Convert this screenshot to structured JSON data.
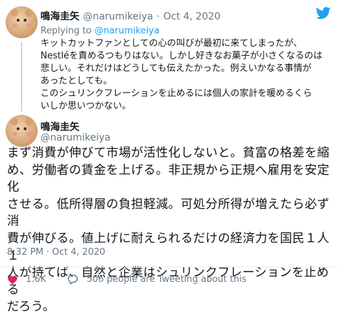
{
  "reply_tweet": {
    "display_name": "鳴海圭矢",
    "handle": "@narumikeiya",
    "dot": "·",
    "date": "Oct 4, 2020",
    "replying_prefix": "Replying to",
    "replying_to": "@narumikeiya",
    "lines": [
      "キットカットファンとしての心の叫びが最初に来てしまったが、",
      "Nestléを責めるつもりはない。しかし好きなお菓子が小さくなるのは",
      "悲しい。それだけはどうしても伝えたかった。例えいかなる事情が",
      "あったとしても。",
      "このシュリンクフレーションを止めるには個人の家計を暖めるくら",
      "いしか思いつかない。"
    ]
  },
  "main_tweet": {
    "display_name": "鳴海圭矢",
    "handle": "@narumikeiya",
    "lines": [
      "まず消費が伸びて市場が活性化しないと。貧富の格差を縮",
      "め、労働者の賃金を上げる。非正規から正規へ雇用を安定化",
      "させる。低所得層の負担軽減。可処分所得が増えたら必ず消",
      "費が伸びる。値上げに耐えられるだけの経済力を国民１人１",
      "人が持てば、自然と企業はシュリンクフレーションを止める",
      "だろう。"
    ],
    "timestamp": "8:32 PM · Oct 4, 2020"
  },
  "actions": {
    "likes": "1.6K",
    "tweeting_about": "506 people are Tweeting about this"
  },
  "colors": {
    "twitter_blue": "#1da1f2",
    "like_red": "#e0245e",
    "secondary_text": "#657786"
  },
  "icons": [
    "avatar",
    "twitter-bird-icon",
    "heart-icon",
    "comment-icon"
  ]
}
